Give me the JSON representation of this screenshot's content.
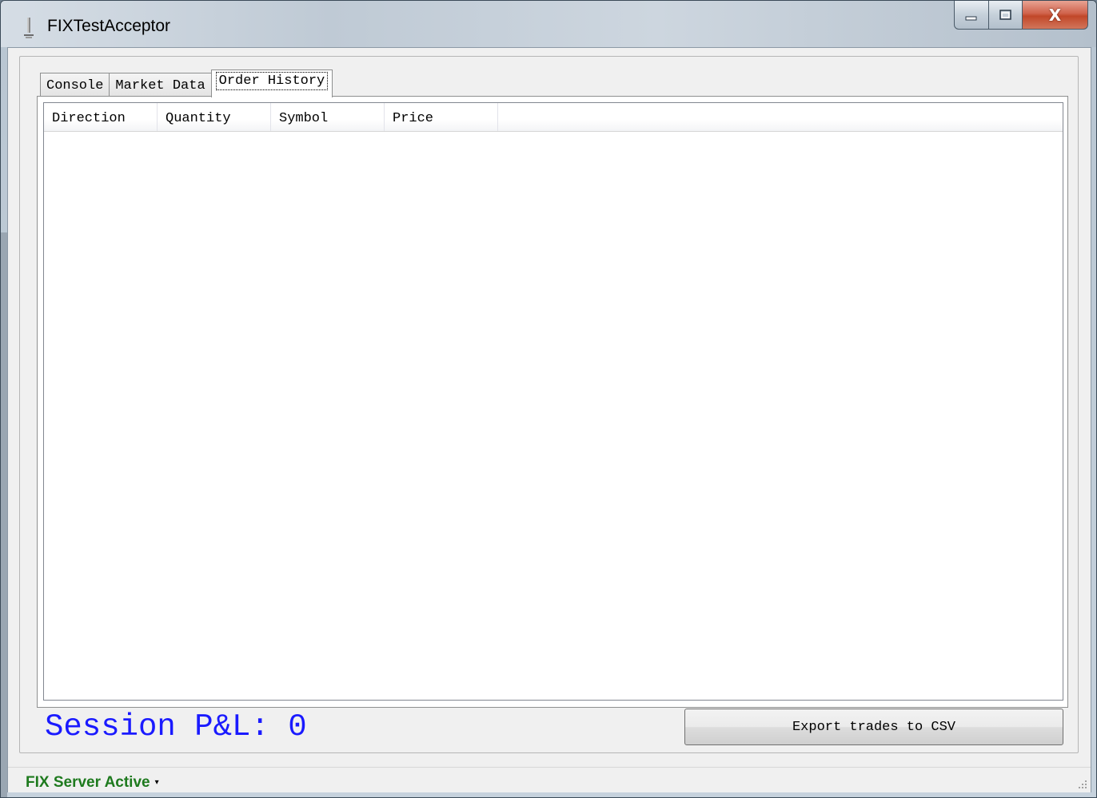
{
  "window": {
    "title": "FIXTestAcceptor",
    "close_glyph": "X"
  },
  "tabs": [
    {
      "label": "Console",
      "active": false
    },
    {
      "label": "Market Data",
      "active": false
    },
    {
      "label": "Order History",
      "active": true
    }
  ],
  "order_history": {
    "columns": [
      "Direction",
      "Quantity",
      "Symbol",
      "Price"
    ],
    "rows": []
  },
  "session_pnl": {
    "text": "Session P&L: 0",
    "color": "#1a1aff"
  },
  "export_button": {
    "label": "Export trades to CSV"
  },
  "statusbar": {
    "status_text": "FIX Server Active",
    "status_color": "#1e7a1e",
    "caret": "▾"
  }
}
